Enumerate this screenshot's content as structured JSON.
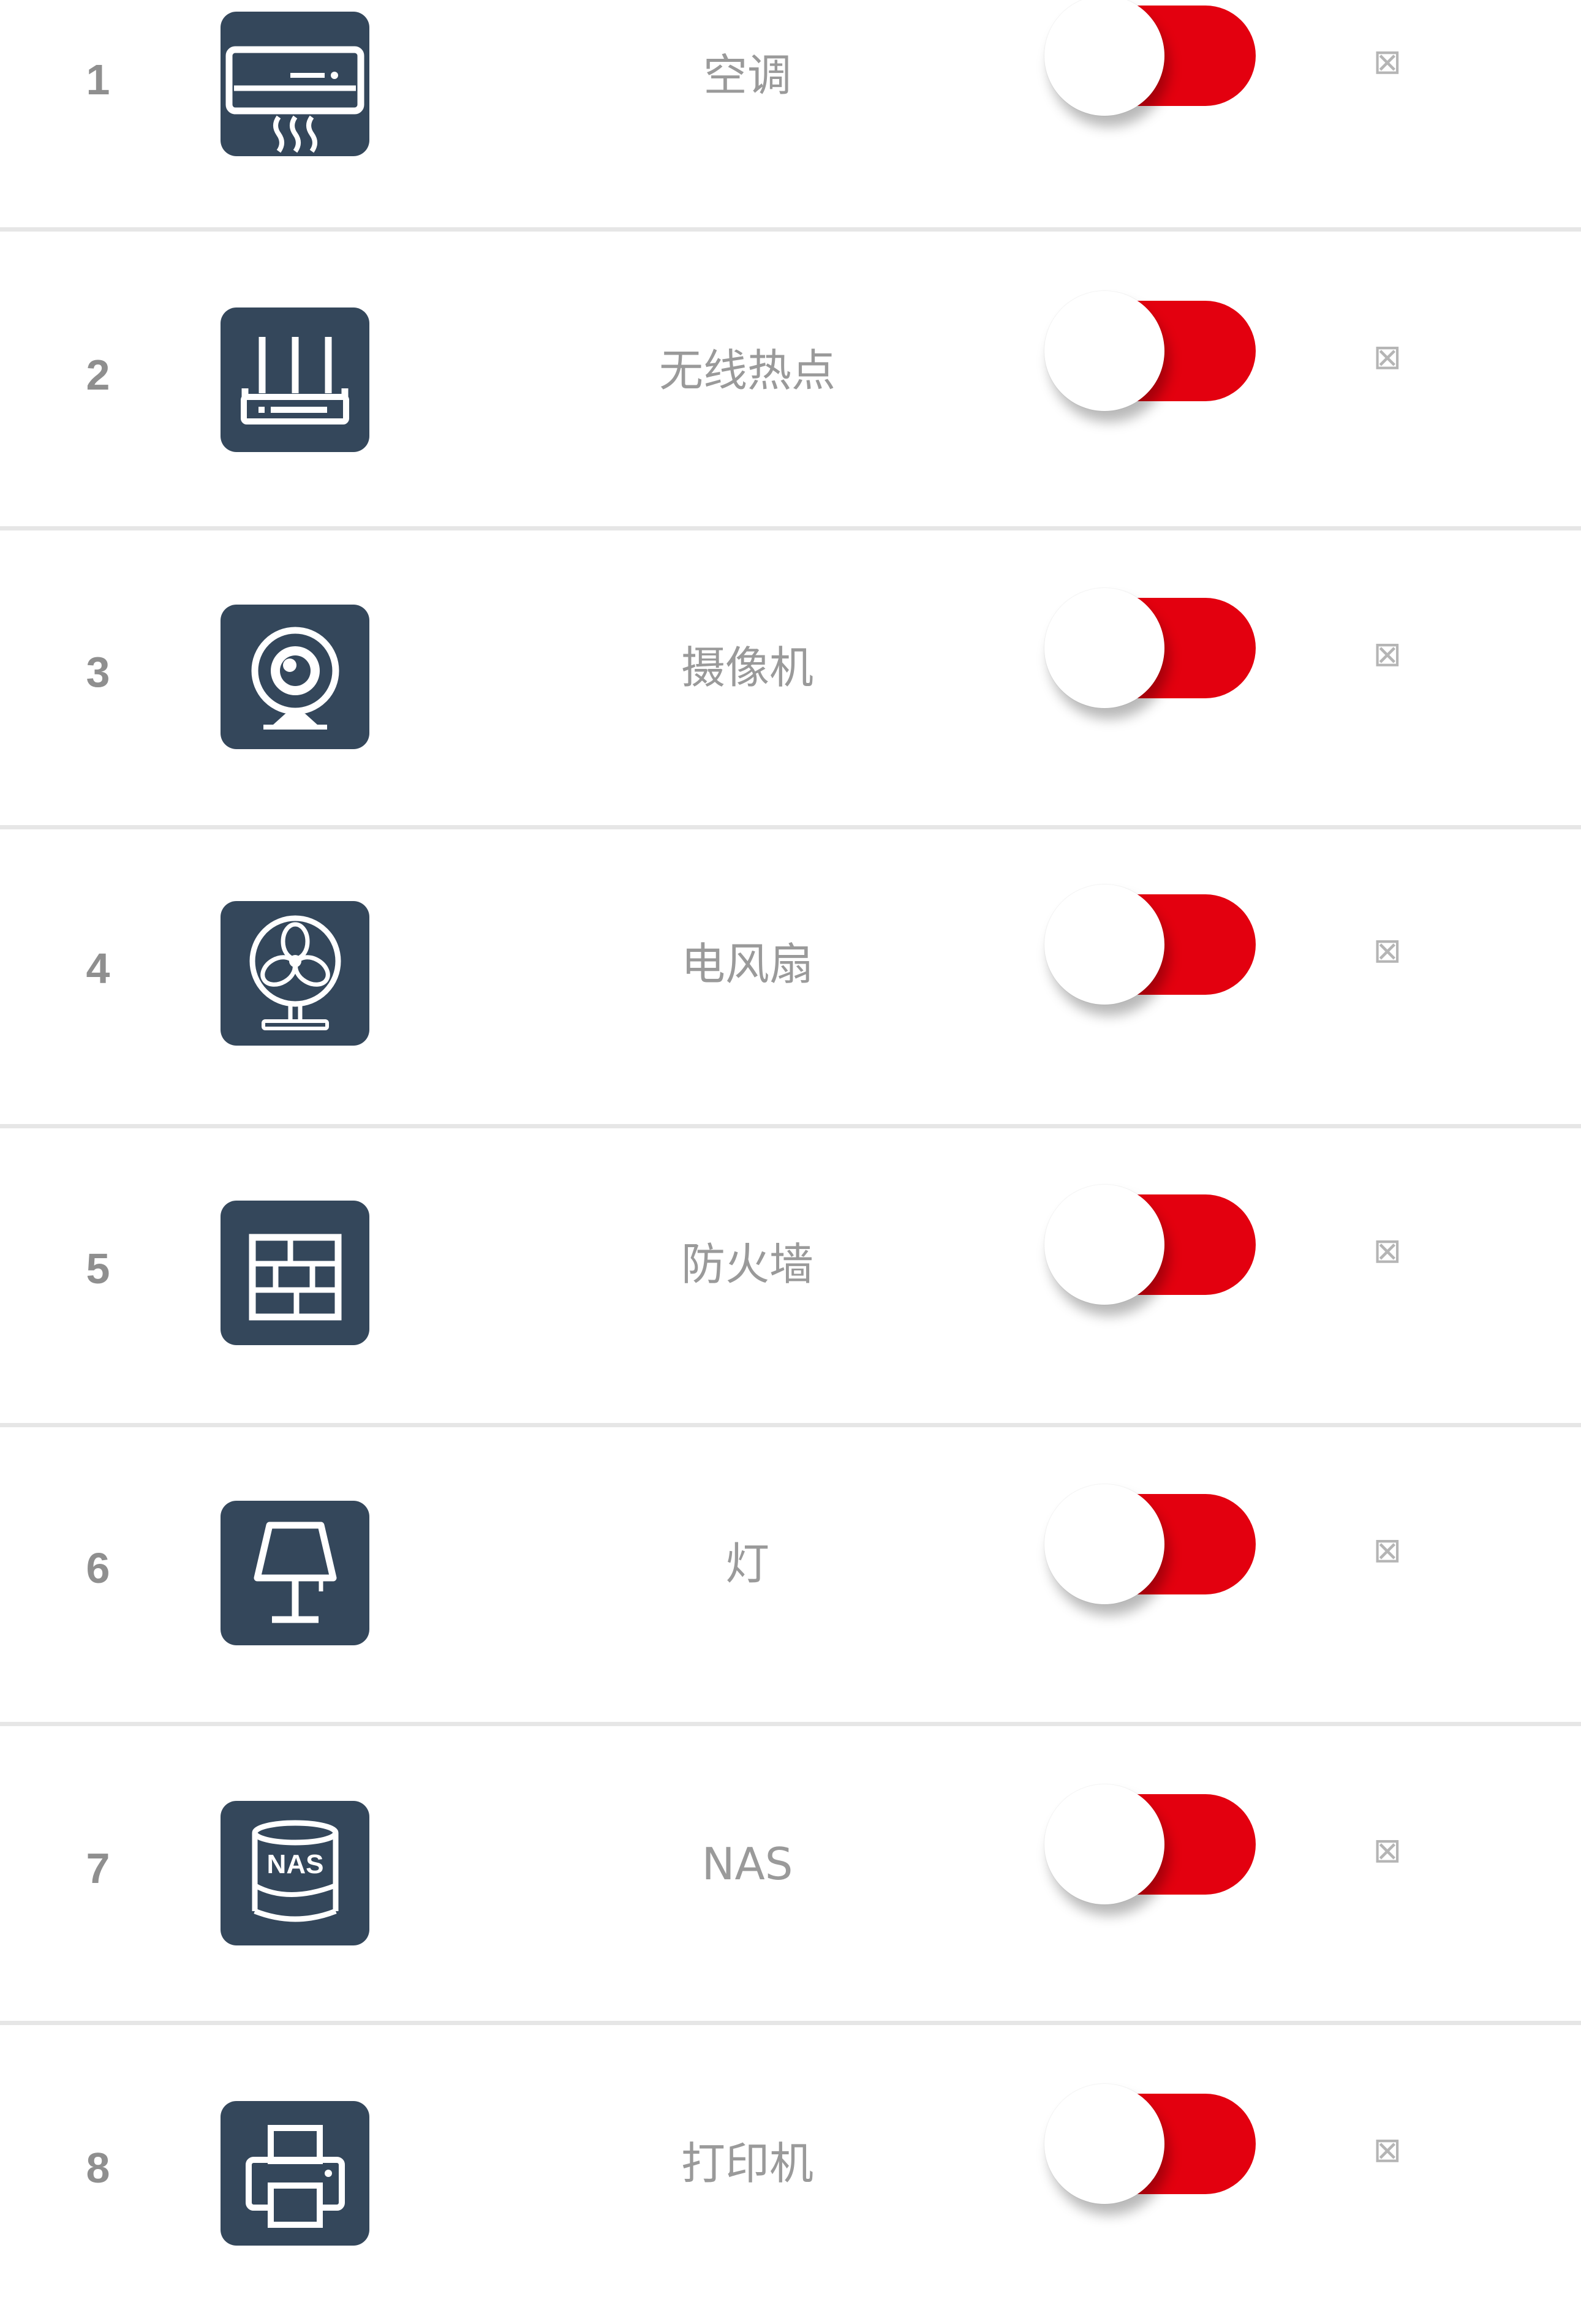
{
  "devices": [
    {
      "index": "1",
      "icon": "air-conditioner-icon",
      "name": "空调",
      "enabled": true,
      "action_glyph": "⊠"
    },
    {
      "index": "2",
      "icon": "wifi-router-icon",
      "name": "无线热点",
      "enabled": true,
      "action_glyph": "⊠"
    },
    {
      "index": "3",
      "icon": "webcam-icon",
      "name": "摄像机",
      "enabled": true,
      "action_glyph": "⊠"
    },
    {
      "index": "4",
      "icon": "electric-fan-icon",
      "name": "电风扇",
      "enabled": true,
      "action_glyph": "⊠"
    },
    {
      "index": "5",
      "icon": "firewall-brick-icon",
      "name": "防火墙",
      "enabled": true,
      "action_glyph": "⊠"
    },
    {
      "index": "6",
      "icon": "table-lamp-icon",
      "name": "灯",
      "enabled": true,
      "action_glyph": "⊠"
    },
    {
      "index": "7",
      "icon": "nas-drive-icon",
      "name": "NAS",
      "enabled": true,
      "action_glyph": "⊠"
    },
    {
      "index": "8",
      "icon": "printer-icon",
      "name": "打印机",
      "enabled": true,
      "action_glyph": "⊠"
    }
  ],
  "colors": {
    "toggle_track": "#e3000f",
    "icon_background": "#34475b",
    "text_muted": "#9a9a9a",
    "divider": "#e6e6e6"
  }
}
